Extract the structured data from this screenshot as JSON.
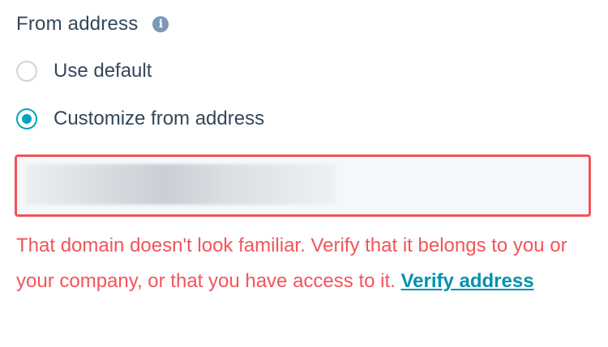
{
  "from_address": {
    "label": "From address",
    "info_icon": "info-circle-icon",
    "options": [
      {
        "label": "Use default",
        "selected": false
      },
      {
        "label": "Customize from address",
        "selected": true
      }
    ],
    "input": {
      "state": "error"
    },
    "error": {
      "message": "That domain doesn't look familiar. Verify that it belongs to you or your company, or that you have access to it.",
      "link_label": "Verify address"
    }
  },
  "colors": {
    "text": "#33475b",
    "accent": "#00a4bd",
    "error": "#f2545b",
    "link": "#0091ae",
    "icon": "#7c98b6"
  }
}
